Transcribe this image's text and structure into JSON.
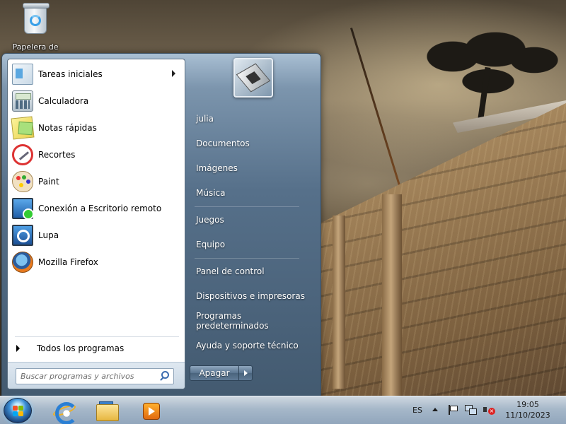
{
  "desktop": {
    "icons": [
      {
        "label": "Papelera de",
        "icon": "recycle-bin-icon"
      }
    ]
  },
  "start_menu": {
    "programs": [
      {
        "label": "Tareas iniciales",
        "icon": "getting-started-icon",
        "has_submenu": true
      },
      {
        "label": "Calculadora",
        "icon": "calculator-icon"
      },
      {
        "label": "Notas rápidas",
        "icon": "sticky-notes-icon"
      },
      {
        "label": "Recortes",
        "icon": "snipping-tool-icon"
      },
      {
        "label": "Paint",
        "icon": "paint-icon"
      },
      {
        "label": "Conexión a Escritorio remoto",
        "icon": "remote-desktop-icon"
      },
      {
        "label": "Lupa",
        "icon": "magnifier-icon"
      },
      {
        "label": "Mozilla Firefox",
        "icon": "firefox-icon"
      }
    ],
    "all_programs_label": "Todos los programas",
    "search": {
      "placeholder": "Buscar programas y archivos",
      "value": ""
    },
    "user_picture_icon": "user-picture-chip-icon",
    "places": [
      {
        "label": "julia"
      },
      {
        "label": "Documentos"
      },
      {
        "label": "Imágenes"
      },
      {
        "label": "Música"
      },
      {
        "label": "Juegos"
      },
      {
        "label": "Equipo"
      },
      {
        "label": "Panel de control"
      },
      {
        "label": "Dispositivos e impresoras"
      },
      {
        "label": "Programas predeterminados"
      },
      {
        "label": "Ayuda y soporte técnico"
      }
    ],
    "shutdown_label": "Apagar"
  },
  "taskbar": {
    "start_icon": "windows-orb-icon",
    "pinned": [
      {
        "name": "Internet Explorer",
        "icon": "internet-explorer-icon"
      },
      {
        "name": "Explorador de Windows",
        "icon": "file-explorer-icon"
      },
      {
        "name": "Reproductor multimedia",
        "icon": "media-player-icon"
      }
    ],
    "language": "ES",
    "tray_icons": [
      "show-hidden-icons-icon",
      "action-center-flag-icon",
      "network-icon",
      "volume-muted-icon"
    ],
    "clock": {
      "time": "19:05",
      "date": "11/10/2023"
    }
  },
  "colors": {
    "start_menu_dark": "#435a70",
    "start_menu_light": "#a9bfd3",
    "taskbar": "#afc3d7",
    "text_light": "#ffffff"
  }
}
